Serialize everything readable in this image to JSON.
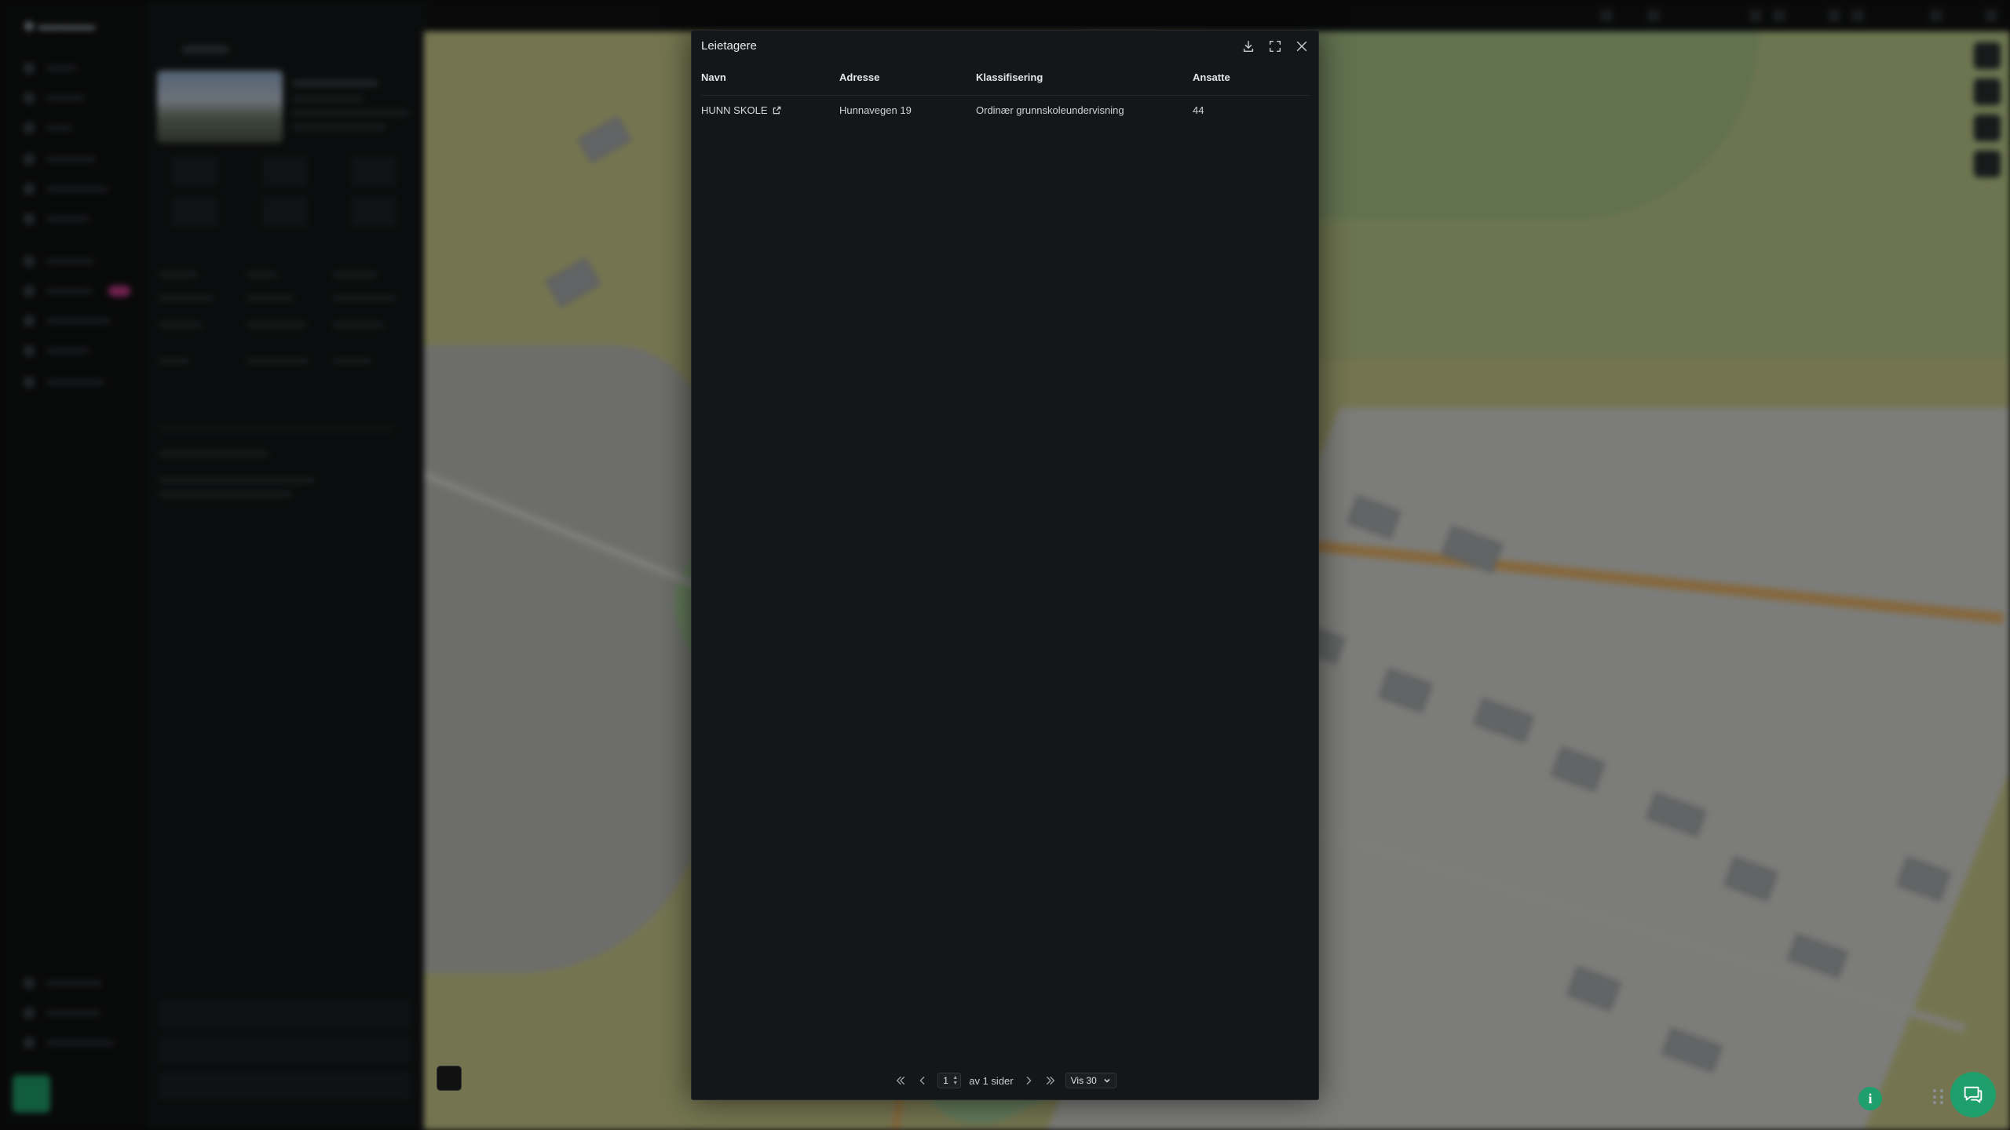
{
  "modal": {
    "title": "Leietagere",
    "actions": [
      {
        "name": "download-button",
        "icon": "download-icon"
      },
      {
        "name": "fullscreen-button",
        "icon": "expand-icon"
      },
      {
        "name": "close-button",
        "icon": "close-icon"
      }
    ],
    "table": {
      "headers": [
        "Navn",
        "Adresse",
        "Klassifisering",
        "Ansatte"
      ],
      "rows": [
        {
          "navn": "HUNN SKOLE",
          "adresse": "Hunnavegen 19",
          "klassifisering": "Ordinær grunnskoleundervisning",
          "ansatte": "44"
        }
      ]
    },
    "pagination": {
      "current_page": "1",
      "of_text": "av 1 sider",
      "page_size_label": "Vis 30"
    }
  },
  "colors": {
    "accent": "#1f9f6c",
    "modal_bg": "#141618",
    "map_field": "#c8c98a"
  }
}
